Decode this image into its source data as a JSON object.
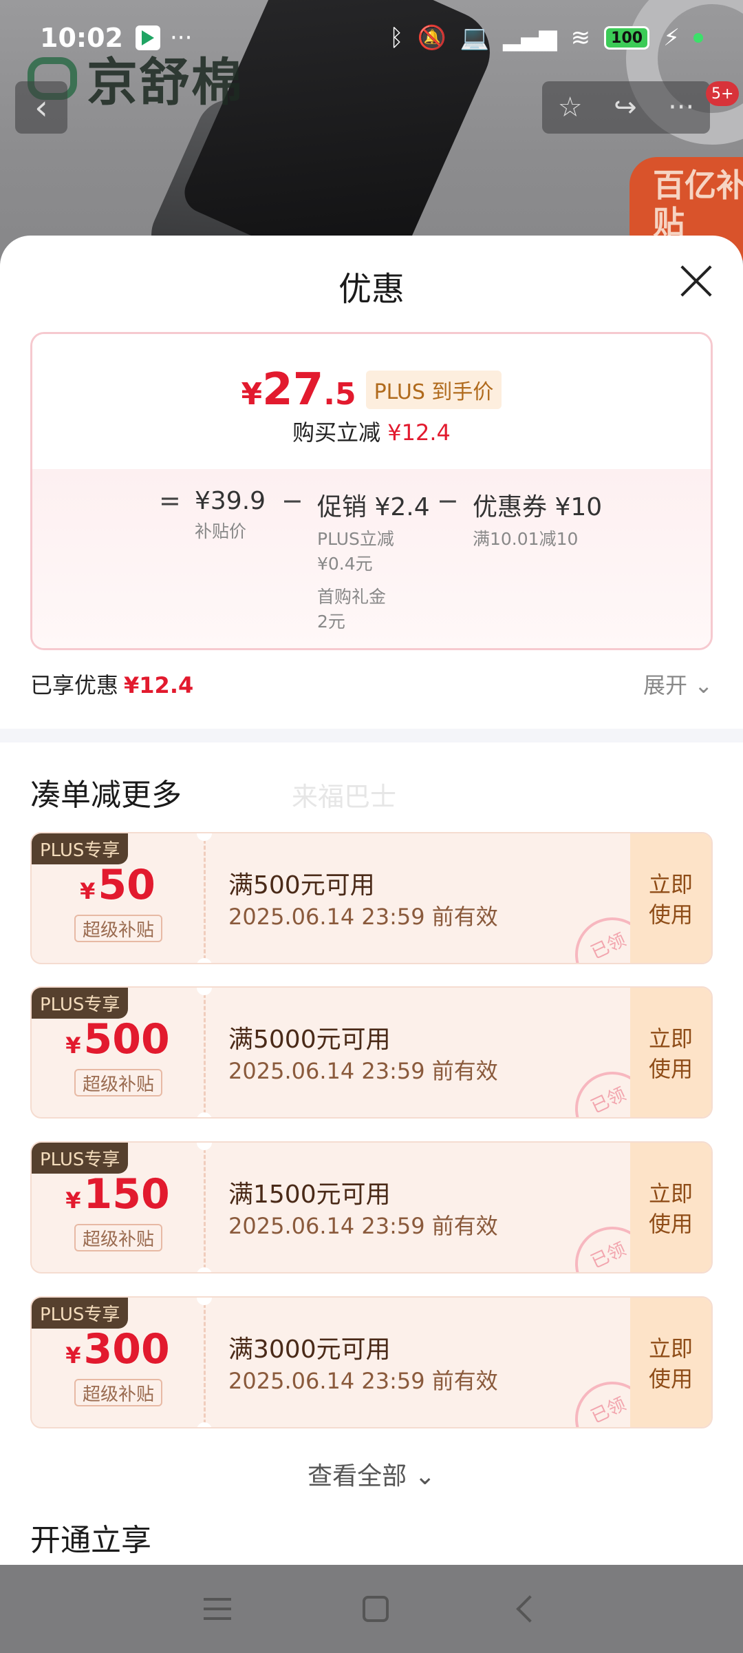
{
  "status_bar": {
    "time": "10:02",
    "dots": "···",
    "battery": "100"
  },
  "backdrop": {
    "brand": "京舒棉",
    "badge": "百亿补贴",
    "cart_count": "5+"
  },
  "sheet": {
    "title": "优惠",
    "summary": {
      "currency": "¥",
      "price_int": "27",
      "price_dec": ".5",
      "plus_label": "PLUS 到手价",
      "reduce_label": "购买立减",
      "reduce_value": "¥12.4",
      "breakdown": {
        "eq": "=",
        "base_price": "¥39.9",
        "base_label": "补贴价",
        "minus": "−",
        "promo_main": "促销 ¥2.4",
        "promo_sub1": "PLUS立减",
        "promo_sub2": "¥0.4元",
        "promo_sub3": "首购礼金",
        "promo_sub4": "2元",
        "coupon_main": "优惠券 ¥10",
        "coupon_sub": "满10.01减10"
      }
    },
    "enjoyed_label": "已享优惠",
    "enjoyed_value": "¥12.4",
    "expand_label": "展开",
    "more_title": "凑单减更多",
    "watermark": "来福巴士",
    "coupons": [
      {
        "tag": "PLUS专享",
        "currency": "¥",
        "amount": "50",
        "badge": "超级补贴",
        "condition": "满500元可用",
        "date": "2025.06.14 23:59 前有效",
        "stamp": "已领",
        "use_label": "立即使用"
      },
      {
        "tag": "PLUS专享",
        "currency": "¥",
        "amount": "500",
        "badge": "超级补贴",
        "condition": "满5000元可用",
        "date": "2025.06.14 23:59 前有效",
        "stamp": "已领",
        "use_label": "立即使用"
      },
      {
        "tag": "PLUS专享",
        "currency": "¥",
        "amount": "150",
        "badge": "超级补贴",
        "condition": "满1500元可用",
        "date": "2025.06.14 23:59 前有效",
        "stamp": "已领",
        "use_label": "立即使用"
      },
      {
        "tag": "PLUS专享",
        "currency": "¥",
        "amount": "300",
        "badge": "超级补贴",
        "condition": "满3000元可用",
        "date": "2025.06.14 23:59 前有效",
        "stamp": "已领",
        "use_label": "立即使用"
      }
    ],
    "view_all": "查看全部",
    "open_title": "开通立享"
  },
  "colors": {
    "price_red": "#e21a2e",
    "coupon_bg": "#fcf0ea",
    "use_bg": "#fde3c8",
    "plus_tag": "#56402e"
  }
}
